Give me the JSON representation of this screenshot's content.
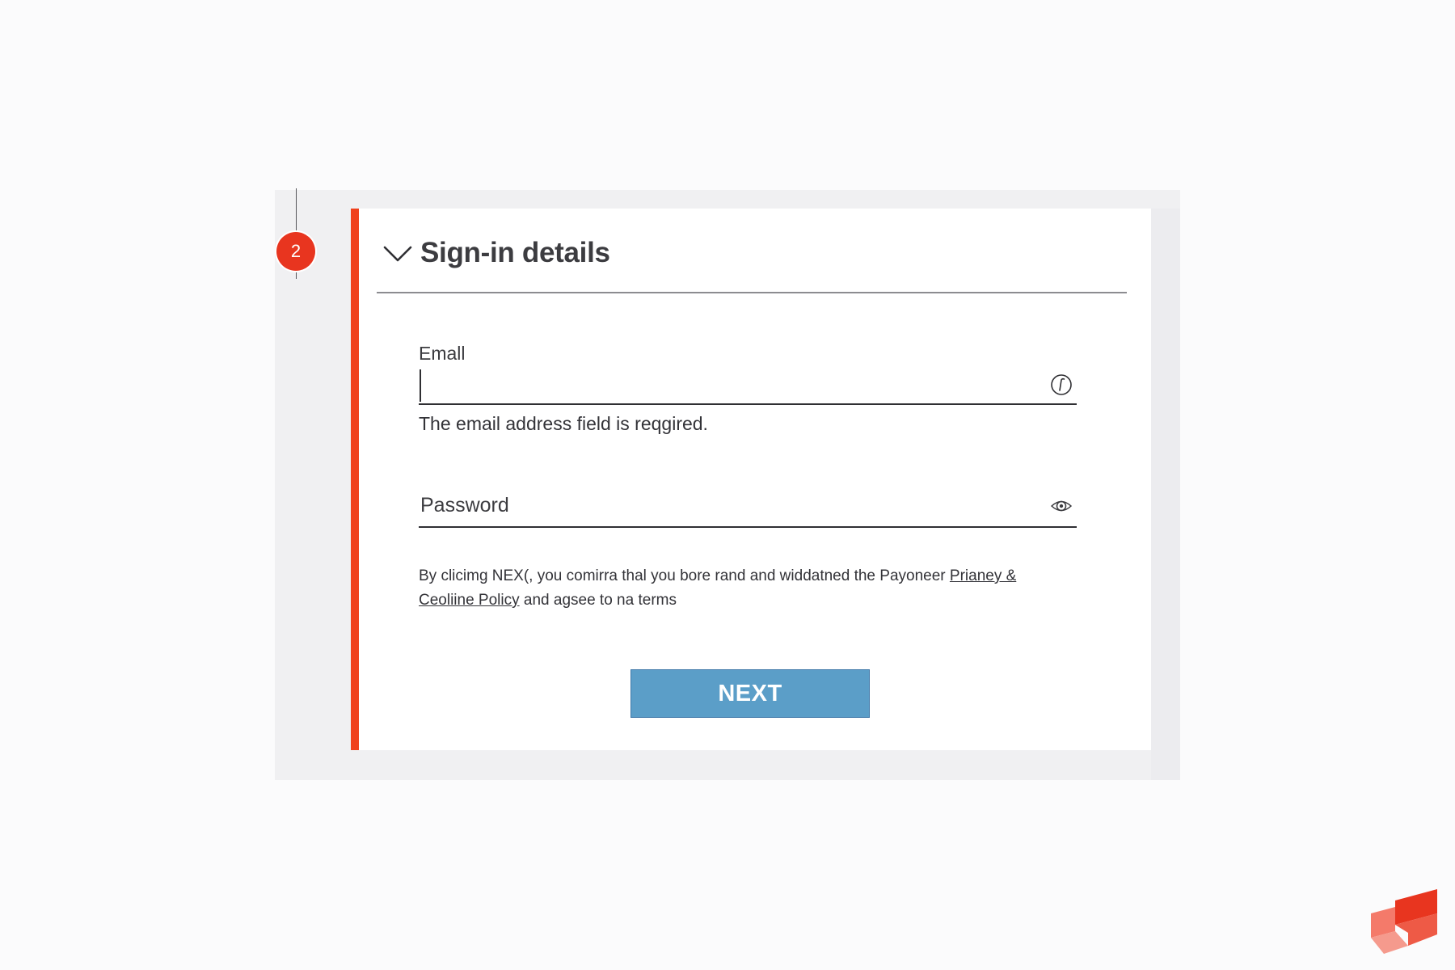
{
  "step": {
    "number": "2"
  },
  "section": {
    "title": "Sign-in details",
    "chevron_icon": "chevron-down-icon"
  },
  "email": {
    "label": "Emall",
    "value": "",
    "icon": "info-circle-icon",
    "error": "The email address field is reqgired."
  },
  "password": {
    "placeholder": "Password",
    "icon": "eye-icon"
  },
  "consent": {
    "prefix": "By clicimg NEX(, you comirra thal you bore rand and widdatned the Payoneer",
    "link_text": "Prianey & Ceoliine Policy",
    "suffix": "and agsee to na terms"
  },
  "actions": {
    "next_label": "NEXT"
  },
  "colors": {
    "accent": "#f0401c",
    "badge": "#e8351f",
    "button": "#5b9ec8",
    "button_border": "#3f78a8"
  },
  "brand": {
    "logo_icon": "brand-logo-icon"
  }
}
